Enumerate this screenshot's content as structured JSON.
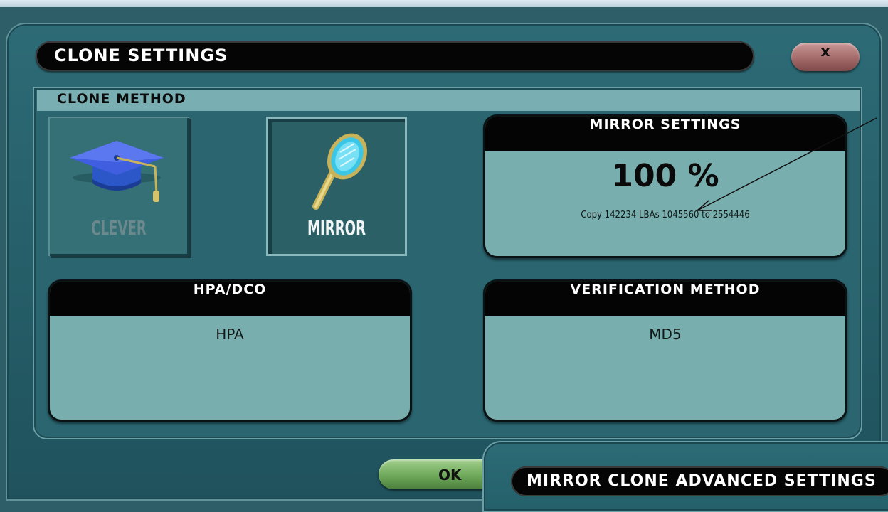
{
  "window": {
    "title": "CLONE SETTINGS",
    "close_label": "x",
    "ok_label": "OK"
  },
  "clone_method": {
    "section_label": "CLONE METHOD",
    "options": [
      {
        "label": "CLEVER",
        "icon": "graduation-cap-icon",
        "selected": false
      },
      {
        "label": "MIRROR",
        "icon": "hand-mirror-icon",
        "selected": true
      }
    ]
  },
  "mirror_settings": {
    "header": "MIRROR SETTINGS",
    "percent": "100 %",
    "copy_text": "Copy 142234 LBAs 1045560 to 2554446"
  },
  "hpa_dco": {
    "header": "HPA/DCO",
    "value": "HPA"
  },
  "verification": {
    "header": "VERIFICATION METHOD",
    "value": "MD5"
  },
  "advanced_window": {
    "title": "MIRROR CLONE ADVANCED SETTINGS"
  },
  "colors": {
    "panel": "#2a6570",
    "card": "#79aeae",
    "header": "#040404",
    "close": "#a46b6a",
    "ok": "#6ea85a"
  }
}
